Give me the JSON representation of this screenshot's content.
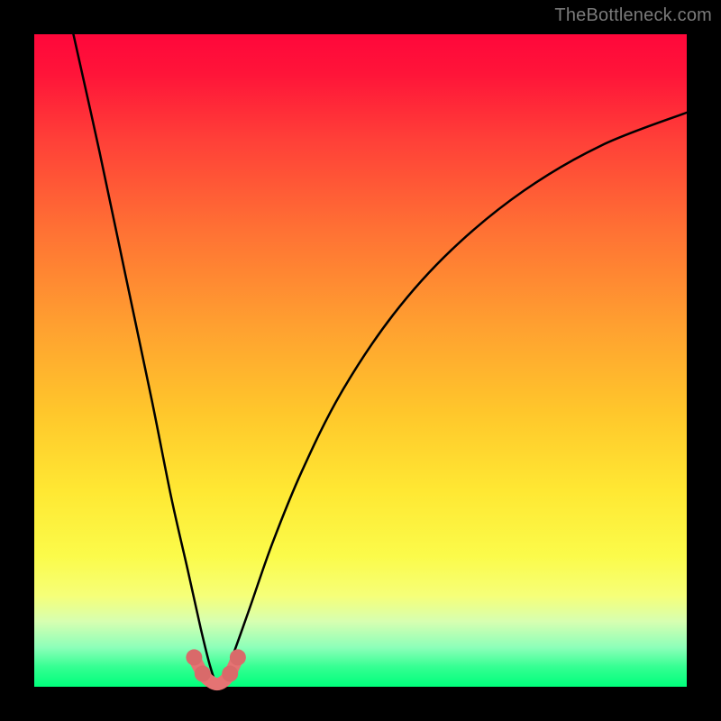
{
  "watermark": "TheBottleneck.com",
  "chart_data": {
    "type": "line",
    "title": "",
    "xlabel": "",
    "ylabel": "",
    "xlim": [
      0,
      100
    ],
    "ylim": [
      0,
      100
    ],
    "grid": false,
    "legend": false,
    "series": [
      {
        "name": "bottleneck-curve",
        "description": "V-shaped curve; left branch steep, right branch shallower; minimum near x≈28",
        "x": [
          6,
          10,
          14,
          18,
          21,
          23.5,
          25.5,
          27,
          28,
          29,
          30.5,
          33,
          36.5,
          41,
          47,
          55,
          64,
          75,
          87,
          100
        ],
        "y": [
          100,
          82,
          63,
          44,
          29,
          18,
          9,
          3,
          0.5,
          1.5,
          5,
          12,
          22,
          33,
          45,
          57,
          67,
          76,
          83,
          88
        ]
      },
      {
        "name": "optimal-zone-marker",
        "description": "Highlighted U-shaped segment at valley bottom indicating balanced / no-bottleneck region",
        "x": [
          24.5,
          25.8,
          27,
          28,
          29,
          30,
          31.2
        ],
        "y": [
          4.5,
          2,
          0.8,
          0.4,
          0.8,
          2,
          4.5
        ]
      }
    ],
    "background_gradient": {
      "top_color": "#ff073a",
      "bottom_color": "#00ff7b",
      "meaning": "red = high bottleneck, green = no bottleneck"
    }
  }
}
